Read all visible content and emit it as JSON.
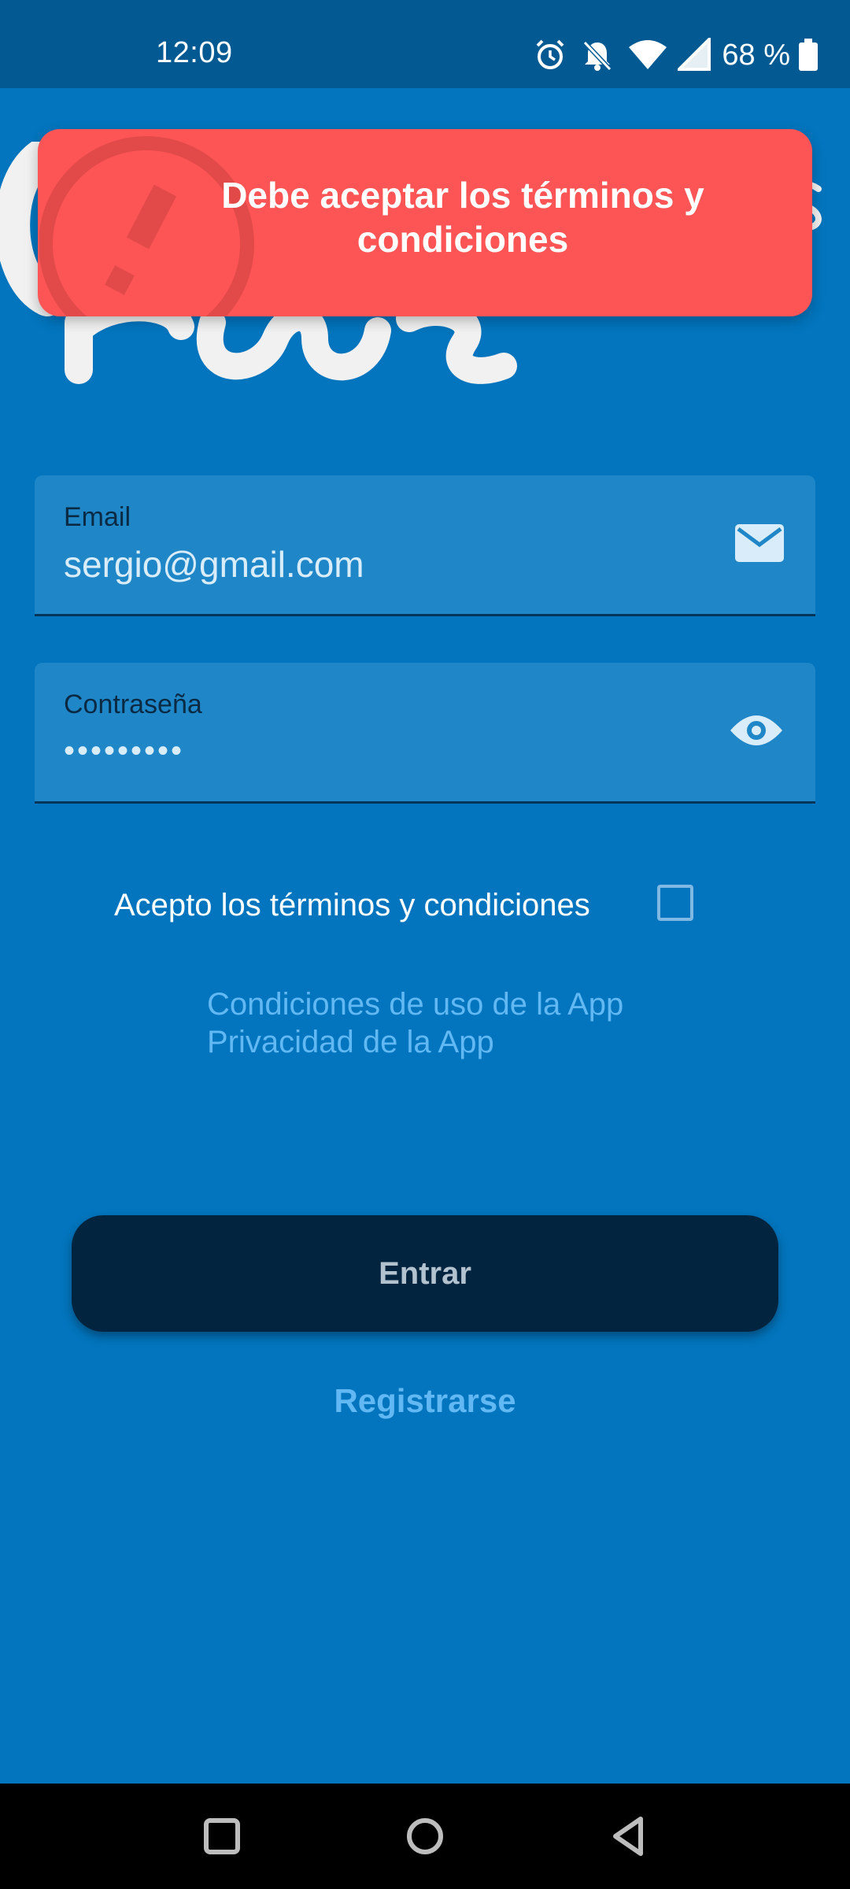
{
  "status_bar": {
    "time": "12:09",
    "battery_percent": "68 %",
    "icons": [
      "alarm-icon",
      "bell-off-icon",
      "wifi-icon",
      "signal-icon",
      "battery-icon"
    ]
  },
  "login": {
    "email": {
      "label": "Email",
      "value": "sergio@gmail.com",
      "icon": "mail-icon"
    },
    "password": {
      "label": "Contraseña",
      "value": "•••••••••",
      "icon": "eye-icon"
    },
    "terms": {
      "label": "Acepto los términos y condiciones",
      "checked": false
    },
    "links": {
      "conditions": "Condiciones de uso de la App",
      "privacy": "Privacidad de la App"
    },
    "enter_button": "Entrar",
    "register_link": "Registrarse"
  },
  "toast": {
    "message": "Debe aceptar los términos y condiciones",
    "icon": "warning-icon"
  },
  "nav_bar": {
    "icons": [
      "recents-icon",
      "home-icon",
      "back-icon"
    ]
  },
  "colors": {
    "background": "#0275be",
    "status_bar": "#035a93",
    "toast": "#fd5555",
    "button": "#03243f",
    "link": "#62b8f3"
  }
}
